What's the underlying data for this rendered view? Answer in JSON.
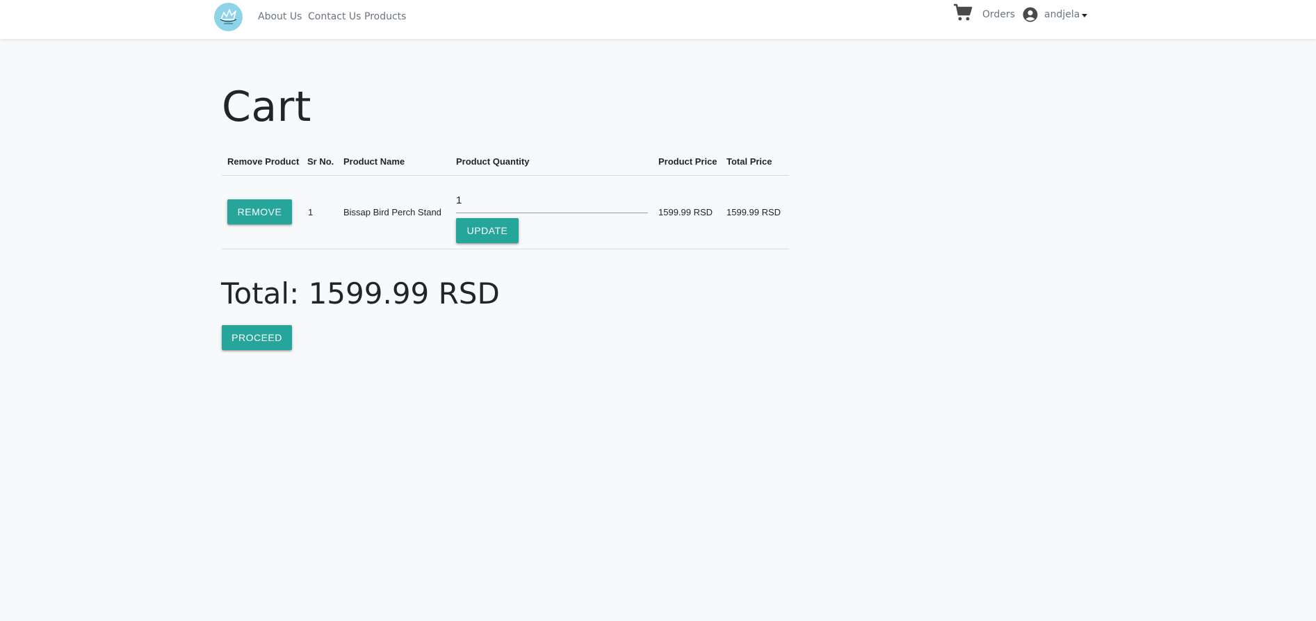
{
  "navbar": {
    "links": [
      "About Us",
      "Contact Us",
      "Products"
    ],
    "orders_label": "Orders",
    "username": "andjela"
  },
  "icons": {
    "logo": "bird-logo-icon",
    "cart": "shopping-cart-icon",
    "user": "user-circle-icon",
    "dropdown": "caret-down-icon"
  },
  "colors": {
    "accent": "#26a69a",
    "logo_bg": "#8fd3e8",
    "page_bg": "#f8f9fa",
    "nav_text": "#6c757d"
  },
  "page": {
    "title": "Cart"
  },
  "table": {
    "headers": [
      "Remove Product",
      "Sr No.",
      "Product Name",
      "Product Quantity",
      "Product Price",
      "Total Price"
    ],
    "rows": [
      {
        "remove_label": "REMOVE",
        "sr_no": "1",
        "product_name": "Bissap Bird Perch Stand",
        "quantity": "1",
        "update_label": "UPDATE",
        "product_price": "1599.99 RSD",
        "total_price": "1599.99 RSD"
      }
    ]
  },
  "summary": {
    "total_text": "Total: 1599.99 RSD",
    "proceed_label": "PROCEED"
  }
}
